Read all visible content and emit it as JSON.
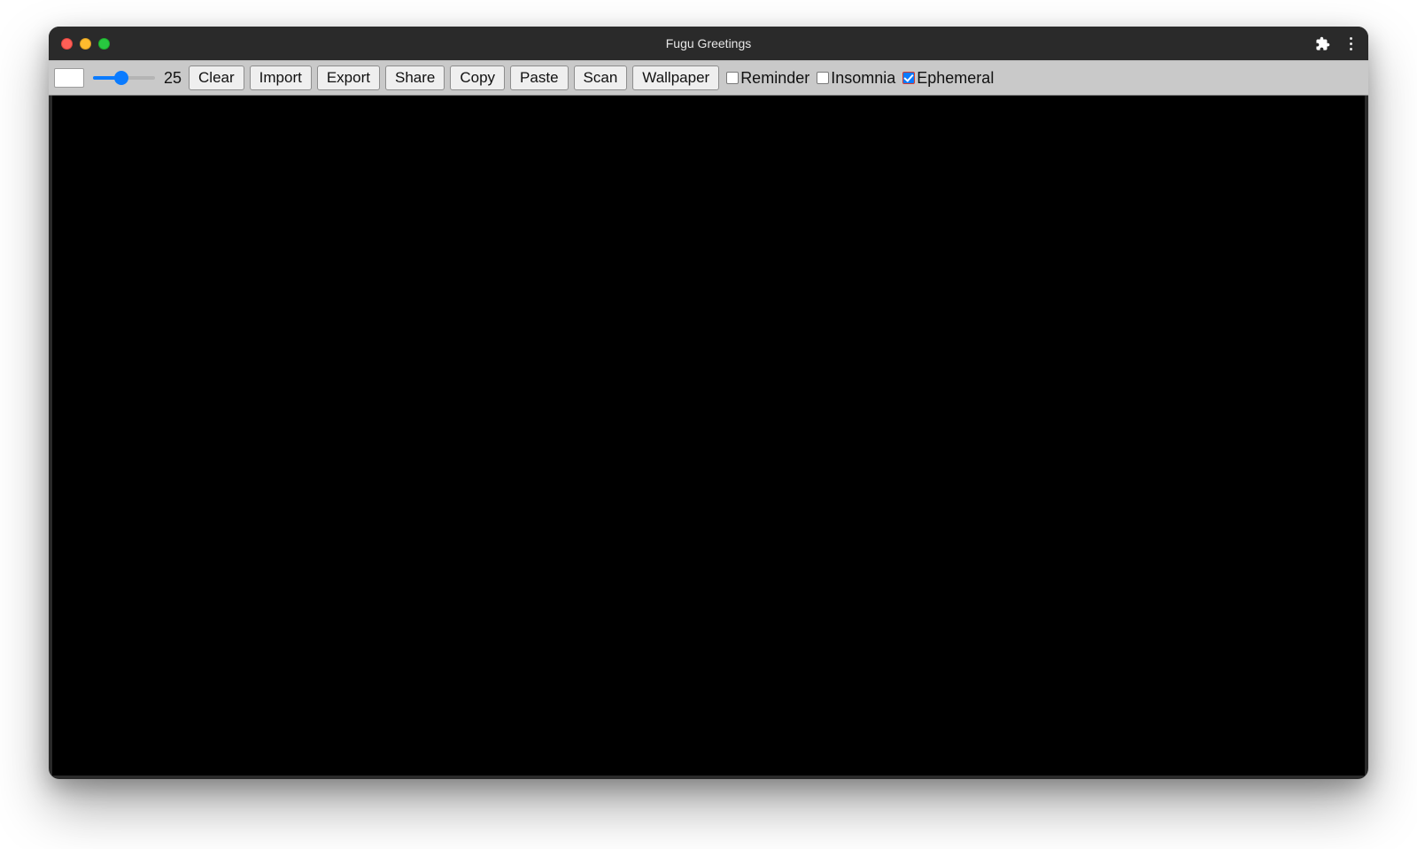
{
  "window": {
    "title": "Fugu Greetings"
  },
  "toolbar": {
    "brush_size": "25",
    "buttons": {
      "clear": "Clear",
      "import": "Import",
      "export": "Export",
      "share": "Share",
      "copy": "Copy",
      "paste": "Paste",
      "scan": "Scan",
      "wallpaper": "Wallpaper"
    },
    "checkboxes": {
      "reminder": {
        "label": "Reminder",
        "checked": false
      },
      "insomnia": {
        "label": "Insomnia",
        "checked": false
      },
      "ephemeral": {
        "label": "Ephemeral",
        "checked": true
      }
    }
  },
  "colors": {
    "accent": "#0a7bff",
    "toolbar_bg": "#c9c9c9",
    "canvas_bg": "#000000",
    "titlebar_bg": "#2a2a2a"
  }
}
